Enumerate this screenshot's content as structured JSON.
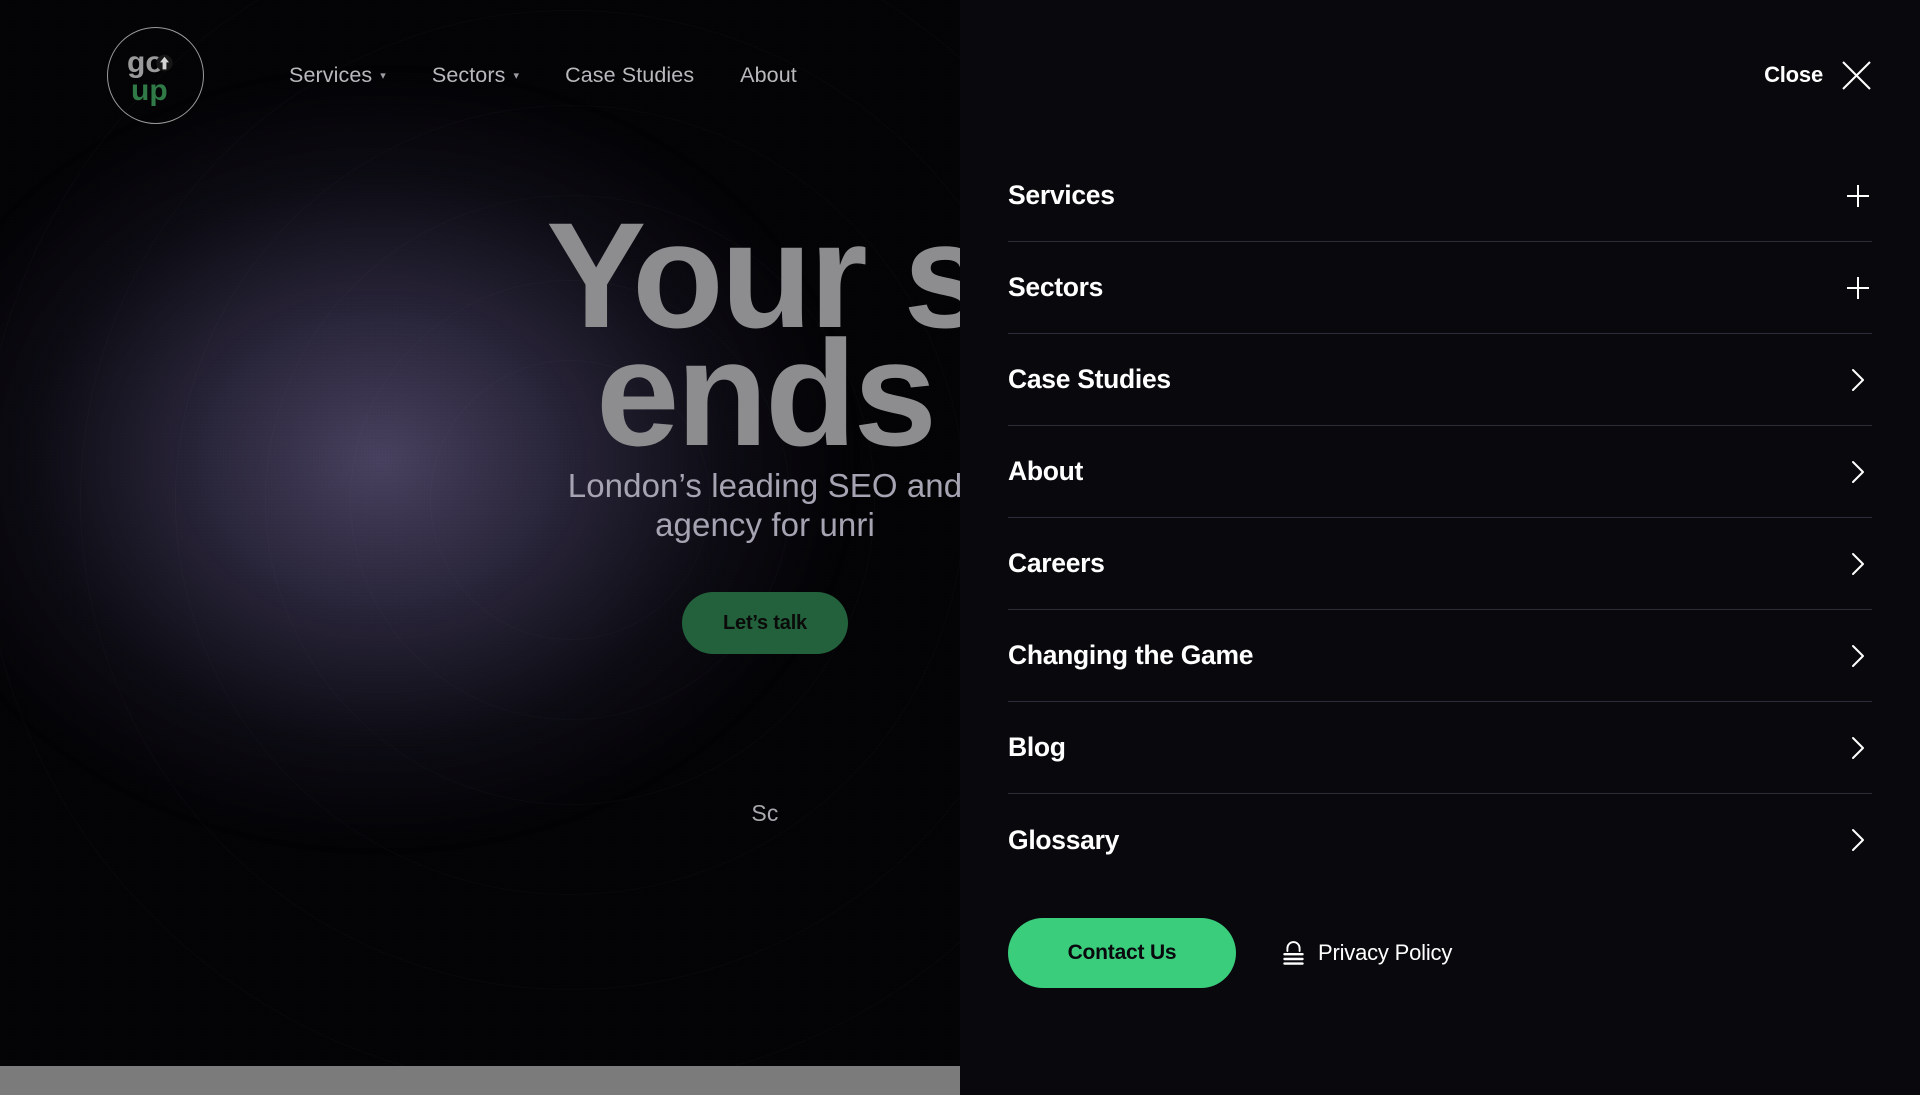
{
  "site": {
    "logo": {
      "name": "goup-logo",
      "top_text": "go",
      "bottom_text": "up",
      "top_color": "#9a9a9a",
      "bottom_color": "#2f7a46"
    }
  },
  "topnav": {
    "items": [
      {
        "label": "Services",
        "has_caret": true
      },
      {
        "label": "Sectors",
        "has_caret": true
      },
      {
        "label": "Case Studies",
        "has_caret": false
      },
      {
        "label": "About",
        "has_caret": false
      }
    ]
  },
  "hero": {
    "heading_line1": "Your s",
    "heading_line2": "ends",
    "sub_line1": "London’s leading SEO and",
    "sub_line2": "agency for unri",
    "cta_label": "Let’s talk",
    "scroll_hint": "Sc"
  },
  "panel": {
    "close_label": "Close",
    "close_icon": "close-x-icon",
    "items": [
      {
        "label": "Services",
        "icon": "plus-icon"
      },
      {
        "label": "Sectors",
        "icon": "plus-icon"
      },
      {
        "label": "Case Studies",
        "icon": "chevron-right-icon"
      },
      {
        "label": "About",
        "icon": "chevron-right-icon"
      },
      {
        "label": "Careers",
        "icon": "chevron-right-icon"
      },
      {
        "label": "Changing the Game",
        "icon": "chevron-right-icon"
      },
      {
        "label": "Blog",
        "icon": "chevron-right-icon"
      },
      {
        "label": "Glossary",
        "icon": "chevron-right-icon"
      }
    ],
    "footer": {
      "contact_label": "Contact Us",
      "privacy_label": "Privacy Policy",
      "privacy_icon": "lock-icon"
    }
  },
  "colors": {
    "accent_green": "#3ACD7C",
    "panel_bg": "#08080d",
    "divider": "#2c2c3a",
    "hero_glow_purple": "#8074a8",
    "scrollbar": "#7b7b7b"
  }
}
